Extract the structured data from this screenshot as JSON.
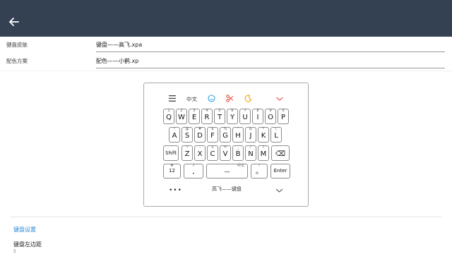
{
  "header": {
    "back_icon": "arrow-left-icon",
    "background": "#334153"
  },
  "form": {
    "skin_label": "键盘皮肤",
    "skin_value": "键盘——高飞.xpa",
    "color_label": "配色方案",
    "color_value": "配色——小鹤.xp"
  },
  "keyboard_preview": {
    "toolbar": {
      "menu_icon": "menu-icon",
      "zh_label": "中文",
      "emoji_icon": "emoji-icon",
      "scissors_icon": "scissors-icon",
      "moon_icon": "moon-icon",
      "collapse_icon": "chevron-down-icon"
    },
    "row1": [
      {
        "k": "Q",
        "s": "1"
      },
      {
        "k": "W",
        "s": "2"
      },
      {
        "k": "E",
        "s": "3"
      },
      {
        "k": "R",
        "s": "4"
      },
      {
        "k": "T",
        "s": "5"
      },
      {
        "k": "Y",
        "s": "6"
      },
      {
        "k": "U",
        "s": "7"
      },
      {
        "k": "I",
        "s": "8"
      },
      {
        "k": "O",
        "s": "9"
      },
      {
        "k": "P",
        "s": "0"
      }
    ],
    "row2": [
      {
        "k": "A",
        "s": "!"
      },
      {
        "k": "S",
        "s": "@"
      },
      {
        "k": "D",
        "s": "#"
      },
      {
        "k": "F",
        "s": "$"
      },
      {
        "k": "G",
        "s": "%"
      },
      {
        "k": "H",
        "s": "^"
      },
      {
        "k": "J",
        "s": "&"
      },
      {
        "k": "K",
        "s": "*"
      },
      {
        "k": "L",
        "s": "("
      }
    ],
    "row3_shift": "Shift",
    "row3": [
      {
        "k": "Z",
        "s": "~"
      },
      {
        "k": "X",
        "s": "-"
      },
      {
        "k": "C",
        "s": "+"
      },
      {
        "k": "V",
        "s": "="
      },
      {
        "k": "B",
        "s": "_"
      },
      {
        "k": "N",
        "s": "/"
      },
      {
        "k": "M",
        "s": "?"
      }
    ],
    "row3_backspace": "⌫",
    "row4": {
      "num": "12",
      "num_sup": "#",
      "comma": ",",
      "comma_sup": "?",
      "space": "—",
      "space_sup": "中文",
      "period": "。",
      "period_sup": "!",
      "enter": "Enter"
    },
    "bottom": {
      "more": "•••",
      "label": "高飞——键盘",
      "arrow_icon": "chevron-down-icon"
    }
  },
  "settings": {
    "section_title": "键盘设置",
    "title_color": "#2a8ad8",
    "left_margin_label": "键盘左边距",
    "left_margin_value": "5"
  }
}
